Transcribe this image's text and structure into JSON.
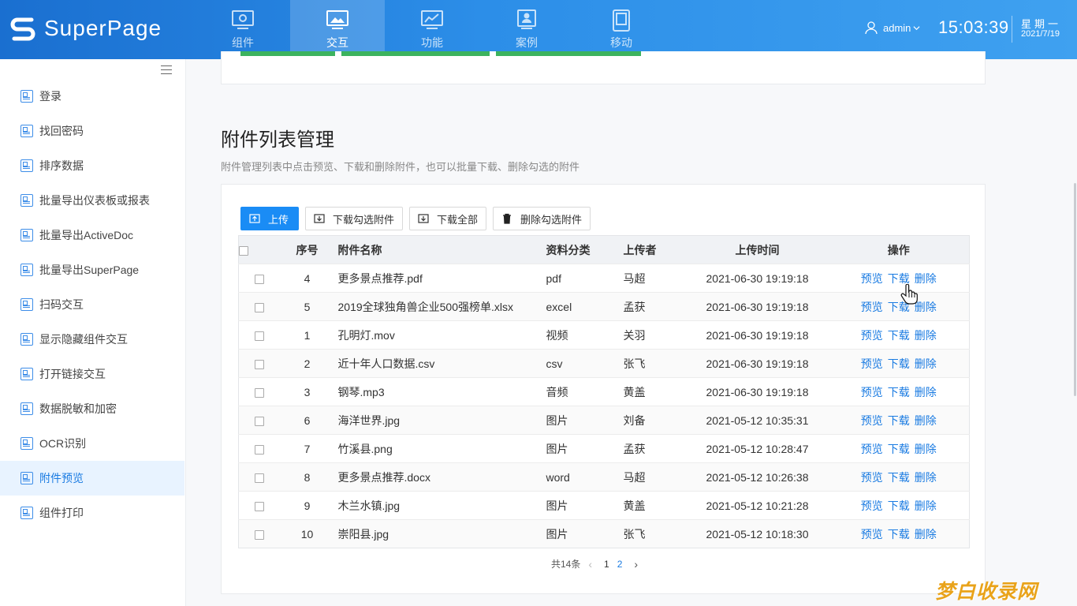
{
  "app": {
    "logo_text": "SuperPage"
  },
  "nav": [
    {
      "label": "组件",
      "icon": "gear-monitor-icon",
      "active": false
    },
    {
      "label": "交互",
      "icon": "image-monitor-icon",
      "active": true
    },
    {
      "label": "功能",
      "icon": "chart-monitor-icon",
      "active": false
    },
    {
      "label": "案例",
      "icon": "person-monitor-icon",
      "active": false
    },
    {
      "label": "移动",
      "icon": "tablet-icon",
      "active": false
    }
  ],
  "header": {
    "user": "admin",
    "time": "15:03:39",
    "weekday": "星期一",
    "date": "2021/7/19"
  },
  "sidebar": {
    "items": [
      {
        "label": "登录"
      },
      {
        "label": "找回密码"
      },
      {
        "label": "排序数据"
      },
      {
        "label": "批量导出仪表板或报表"
      },
      {
        "label": "批量导出ActiveDoc"
      },
      {
        "label": "批量导出SuperPage"
      },
      {
        "label": "扫码交互"
      },
      {
        "label": "显示隐藏组件交互"
      },
      {
        "label": "打开链接交互"
      },
      {
        "label": "数据脱敏和加密"
      },
      {
        "label": "OCR识别"
      },
      {
        "label": "附件预览"
      },
      {
        "label": "组件打印"
      }
    ],
    "active_index": 11
  },
  "section": {
    "title": "附件列表管理",
    "description": "附件管理列表中点击预览、下载和删除附件，也可以批量下载、删除勾选的附件"
  },
  "toolbar": {
    "upload": "上传",
    "download_selected": "下载勾选附件",
    "download_all": "下载全部",
    "delete_selected": "删除勾选附件"
  },
  "table": {
    "headers": {
      "no": "序号",
      "name": "附件名称",
      "type": "资料分类",
      "uploader": "上传者",
      "time": "上传时间",
      "ops": "操作"
    },
    "op_labels": {
      "preview": "预览",
      "download": "下载",
      "delete": "删除"
    },
    "rows": [
      {
        "no": "4",
        "name": "更多景点推荐.pdf",
        "type": "pdf",
        "uploader": "马超",
        "time": "2021-06-30 19:19:18"
      },
      {
        "no": "5",
        "name": "2019全球独角兽企业500强榜单.xlsx",
        "type": "excel",
        "uploader": "孟获",
        "time": "2021-06-30 19:19:18"
      },
      {
        "no": "1",
        "name": "孔明灯.mov",
        "type": "视频",
        "uploader": "关羽",
        "time": "2021-06-30 19:19:18"
      },
      {
        "no": "2",
        "name": "近十年人口数据.csv",
        "type": "csv",
        "uploader": "张飞",
        "time": "2021-06-30 19:19:18"
      },
      {
        "no": "3",
        "name": "钢琴.mp3",
        "type": "音频",
        "uploader": "黄盖",
        "time": "2021-06-30 19:19:18"
      },
      {
        "no": "6",
        "name": "海洋世界.jpg",
        "type": "图片",
        "uploader": "刘备",
        "time": "2021-05-12 10:35:31"
      },
      {
        "no": "7",
        "name": "竹溪县.png",
        "type": "图片",
        "uploader": "孟获",
        "time": "2021-05-12 10:28:47"
      },
      {
        "no": "8",
        "name": "更多景点推荐.docx",
        "type": "word",
        "uploader": "马超",
        "time": "2021-05-12 10:26:38"
      },
      {
        "no": "9",
        "name": "木兰水镇.jpg",
        "type": "图片",
        "uploader": "黄盖",
        "time": "2021-05-12 10:21:28"
      },
      {
        "no": "10",
        "name": "崇阳县.jpg",
        "type": "图片",
        "uploader": "张飞",
        "time": "2021-05-12 10:18:30"
      }
    ]
  },
  "pager": {
    "total": "共14条",
    "pages": [
      "1",
      "2"
    ],
    "current": "1"
  },
  "watermark": "梦白收录网",
  "colors": {
    "header_start": "#1a6fd0",
    "header_end": "#3fa1f0",
    "primary": "#1a8cf5",
    "link": "#1a7be2",
    "active_bg": "#e8f3ff",
    "green": "#3cb35e"
  }
}
